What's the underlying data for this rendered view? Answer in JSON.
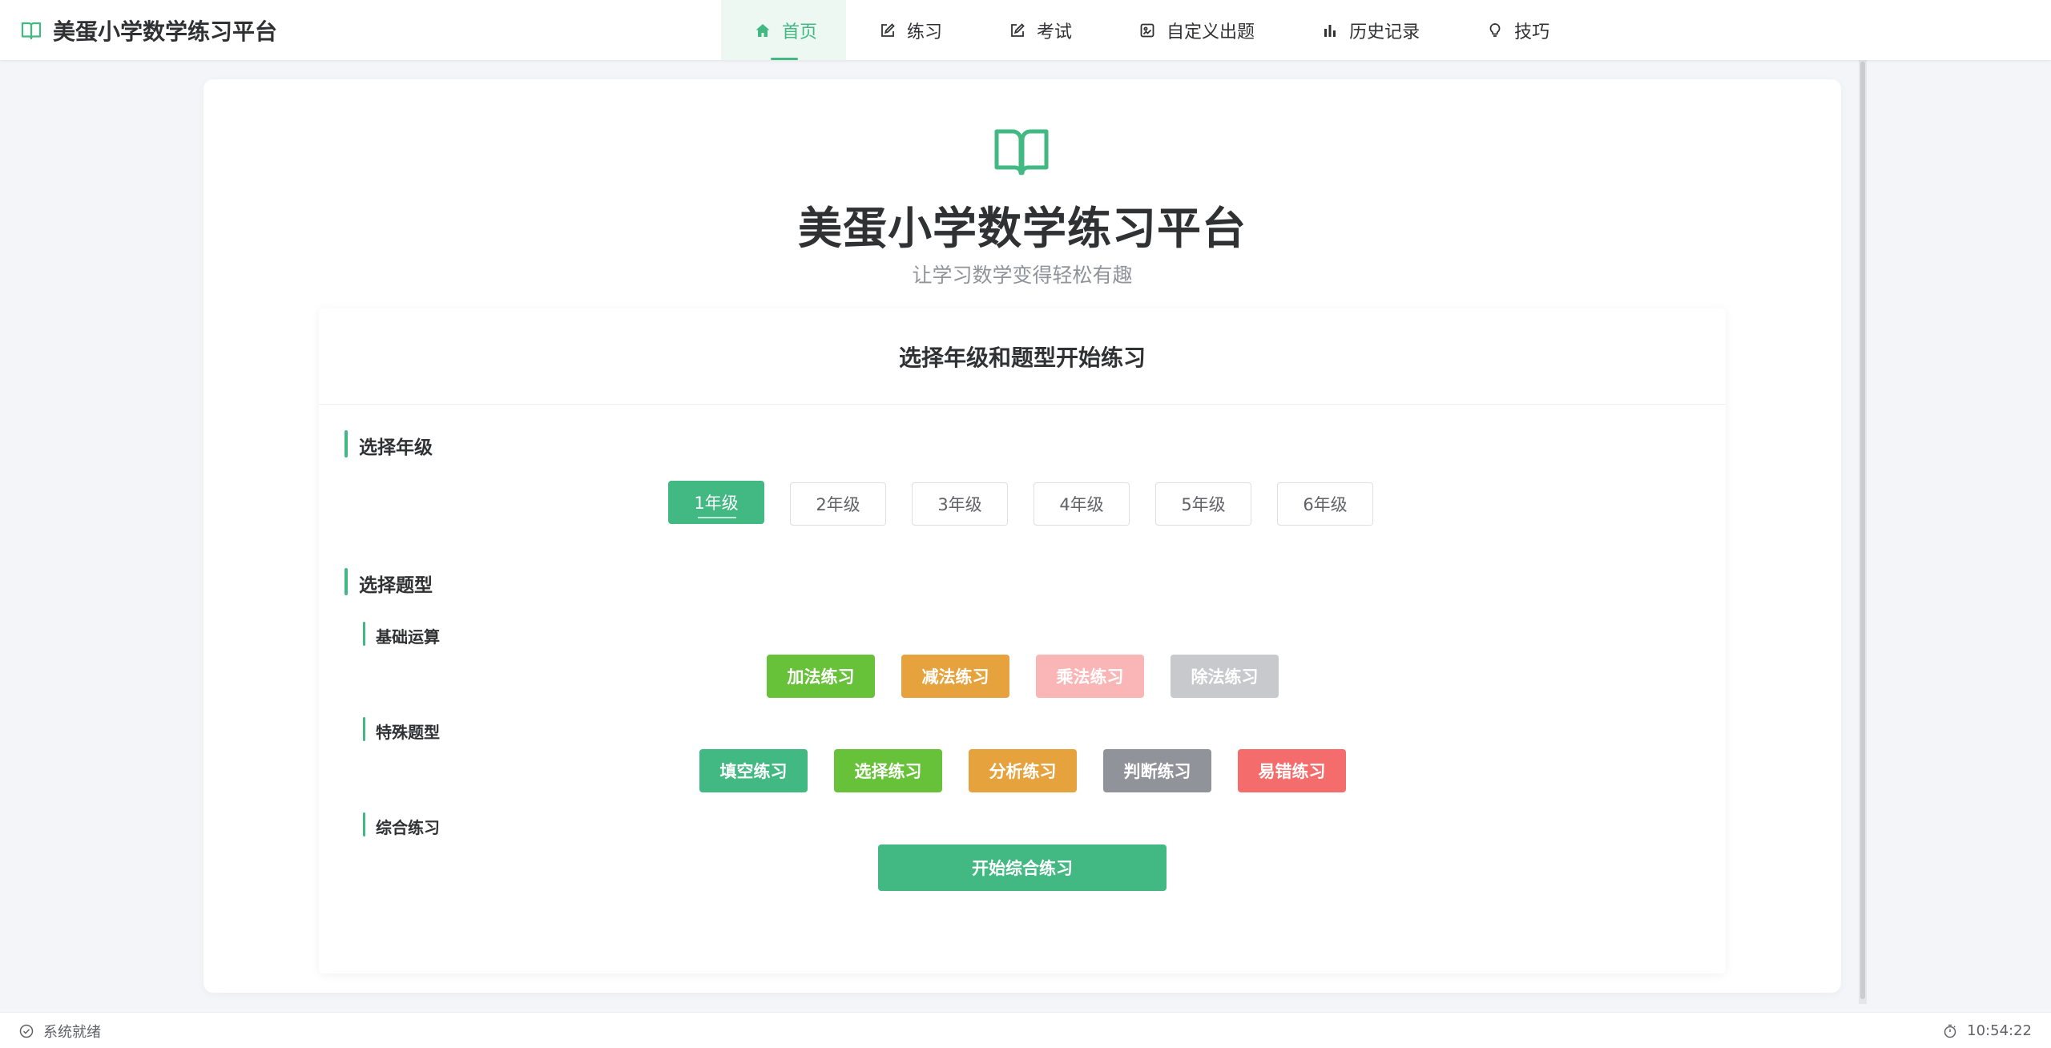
{
  "app": {
    "title": "美蛋小学数学练习平台"
  },
  "nav": {
    "items": [
      {
        "label": "首页",
        "icon": "home-icon",
        "active": true
      },
      {
        "label": "练习",
        "icon": "edit-icon",
        "active": false
      },
      {
        "label": "考试",
        "icon": "edit-icon",
        "active": false
      },
      {
        "label": "自定义出题",
        "icon": "custom-icon",
        "active": false
      },
      {
        "label": "历史记录",
        "icon": "bar-chart-icon",
        "active": false
      },
      {
        "label": "技巧",
        "icon": "lightbulb-icon",
        "active": false
      }
    ]
  },
  "hero": {
    "icon": "book-icon",
    "title": "美蛋小学数学练习平台",
    "subtitle": "让学习数学变得轻松有趣"
  },
  "panel": {
    "header": "选择年级和题型开始练习",
    "grade_section": "选择年级",
    "grades": [
      "1年级",
      "2年级",
      "3年级",
      "4年级",
      "5年级",
      "6年级"
    ],
    "selected_grade": "1年级",
    "type_section": "选择题型",
    "basic": {
      "title": "基础运算",
      "buttons": [
        {
          "label": "加法练习",
          "color": "#67c23a"
        },
        {
          "label": "减法练习",
          "color": "#e6a23c"
        },
        {
          "label": "乘法练习",
          "color": "#fab6b6"
        },
        {
          "label": "除法练习",
          "color": "#c8c9cc"
        }
      ]
    },
    "special": {
      "title": "特殊题型",
      "buttons": [
        {
          "label": "填空练习",
          "color": "#42b883"
        },
        {
          "label": "选择练习",
          "color": "#67c23a"
        },
        {
          "label": "分析练习",
          "color": "#e6a23c"
        },
        {
          "label": "判断练习",
          "color": "#909399"
        },
        {
          "label": "易错练习",
          "color": "#f56c6c"
        }
      ]
    },
    "comprehensive": {
      "title": "综合练习",
      "start_label": "开始综合练习"
    }
  },
  "status": {
    "text": "系统就绪",
    "time": "10:54:22"
  },
  "colors": {
    "accent": "#42b883"
  }
}
